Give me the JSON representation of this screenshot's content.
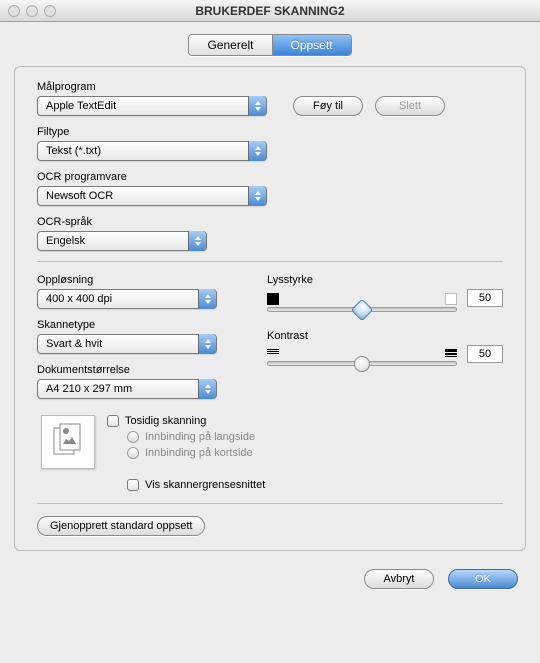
{
  "window": {
    "title": "BRUKERDEF SKANNING2"
  },
  "tabs": {
    "general": "Generelt",
    "settings": "Oppsett",
    "active": "settings"
  },
  "labels": {
    "target_app": "Målprogram",
    "file_type": "Filtype",
    "ocr_software": "OCR programvare",
    "ocr_language": "OCR-språk",
    "resolution": "Oppløsning",
    "scan_type": "Skannetype",
    "doc_size": "Dokumentstørrelse",
    "brightness": "Lysstyrke",
    "contrast": "Kontrast"
  },
  "values": {
    "target_app": "Apple TextEdit",
    "file_type": "Tekst (*.txt)",
    "ocr_software": "Newsoft OCR",
    "ocr_language": "Engelsk",
    "resolution": "400 x 400 dpi",
    "scan_type": "Svart & hvit",
    "doc_size": "A4  210 x 297 mm",
    "brightness": "50",
    "contrast": "50"
  },
  "buttons": {
    "add": "Føy til",
    "delete": "Slett",
    "restore_defaults": "Gjenopprett standard oppsett",
    "cancel": "Avbryt",
    "ok": "OK"
  },
  "checks": {
    "duplex": "Tosidig skanning",
    "bind_long": "Innbinding på langside",
    "bind_short": "Innbinding på kortside",
    "show_interface": "Vis skannergrensesnittet"
  }
}
